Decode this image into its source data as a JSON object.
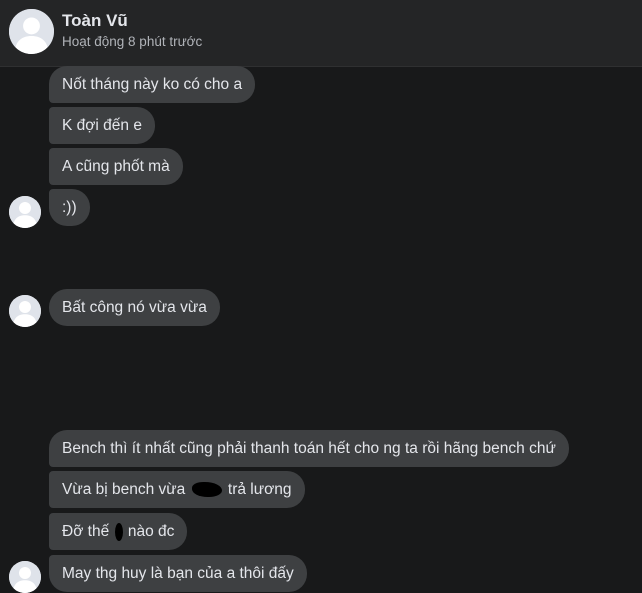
{
  "header": {
    "name": "Toàn Vũ",
    "status": "Hoạt động 8 phút trước"
  },
  "messages": [
    {
      "text": "Nốt tháng này ko có cho a"
    },
    {
      "text": "K đợi đến e"
    },
    {
      "text": "A cũng phốt mà"
    },
    {
      "text": ":))"
    },
    {
      "text": "Bất công nó vừa vừa"
    },
    {
      "text": "Bench thì ít nhất cũng phải thanh toán hết cho ng ta rồi hãng bench chứ"
    },
    {
      "text_before": "Vừa bị bench vừa",
      "text_after": "trả lương"
    },
    {
      "text_before": "Đỡ thế",
      "text_after": "nào đc"
    },
    {
      "text": "May thg huy là bạn của a thôi đấy"
    }
  ],
  "colors": {
    "background": "#18191a",
    "header_background": "#242526",
    "bubble": "#3e4042",
    "text": "#e4e6eb",
    "secondary_text": "#b0b3b8",
    "avatar": "#dfe3ea"
  },
  "icons": {
    "avatar": "default-profile-silhouette-icon"
  }
}
